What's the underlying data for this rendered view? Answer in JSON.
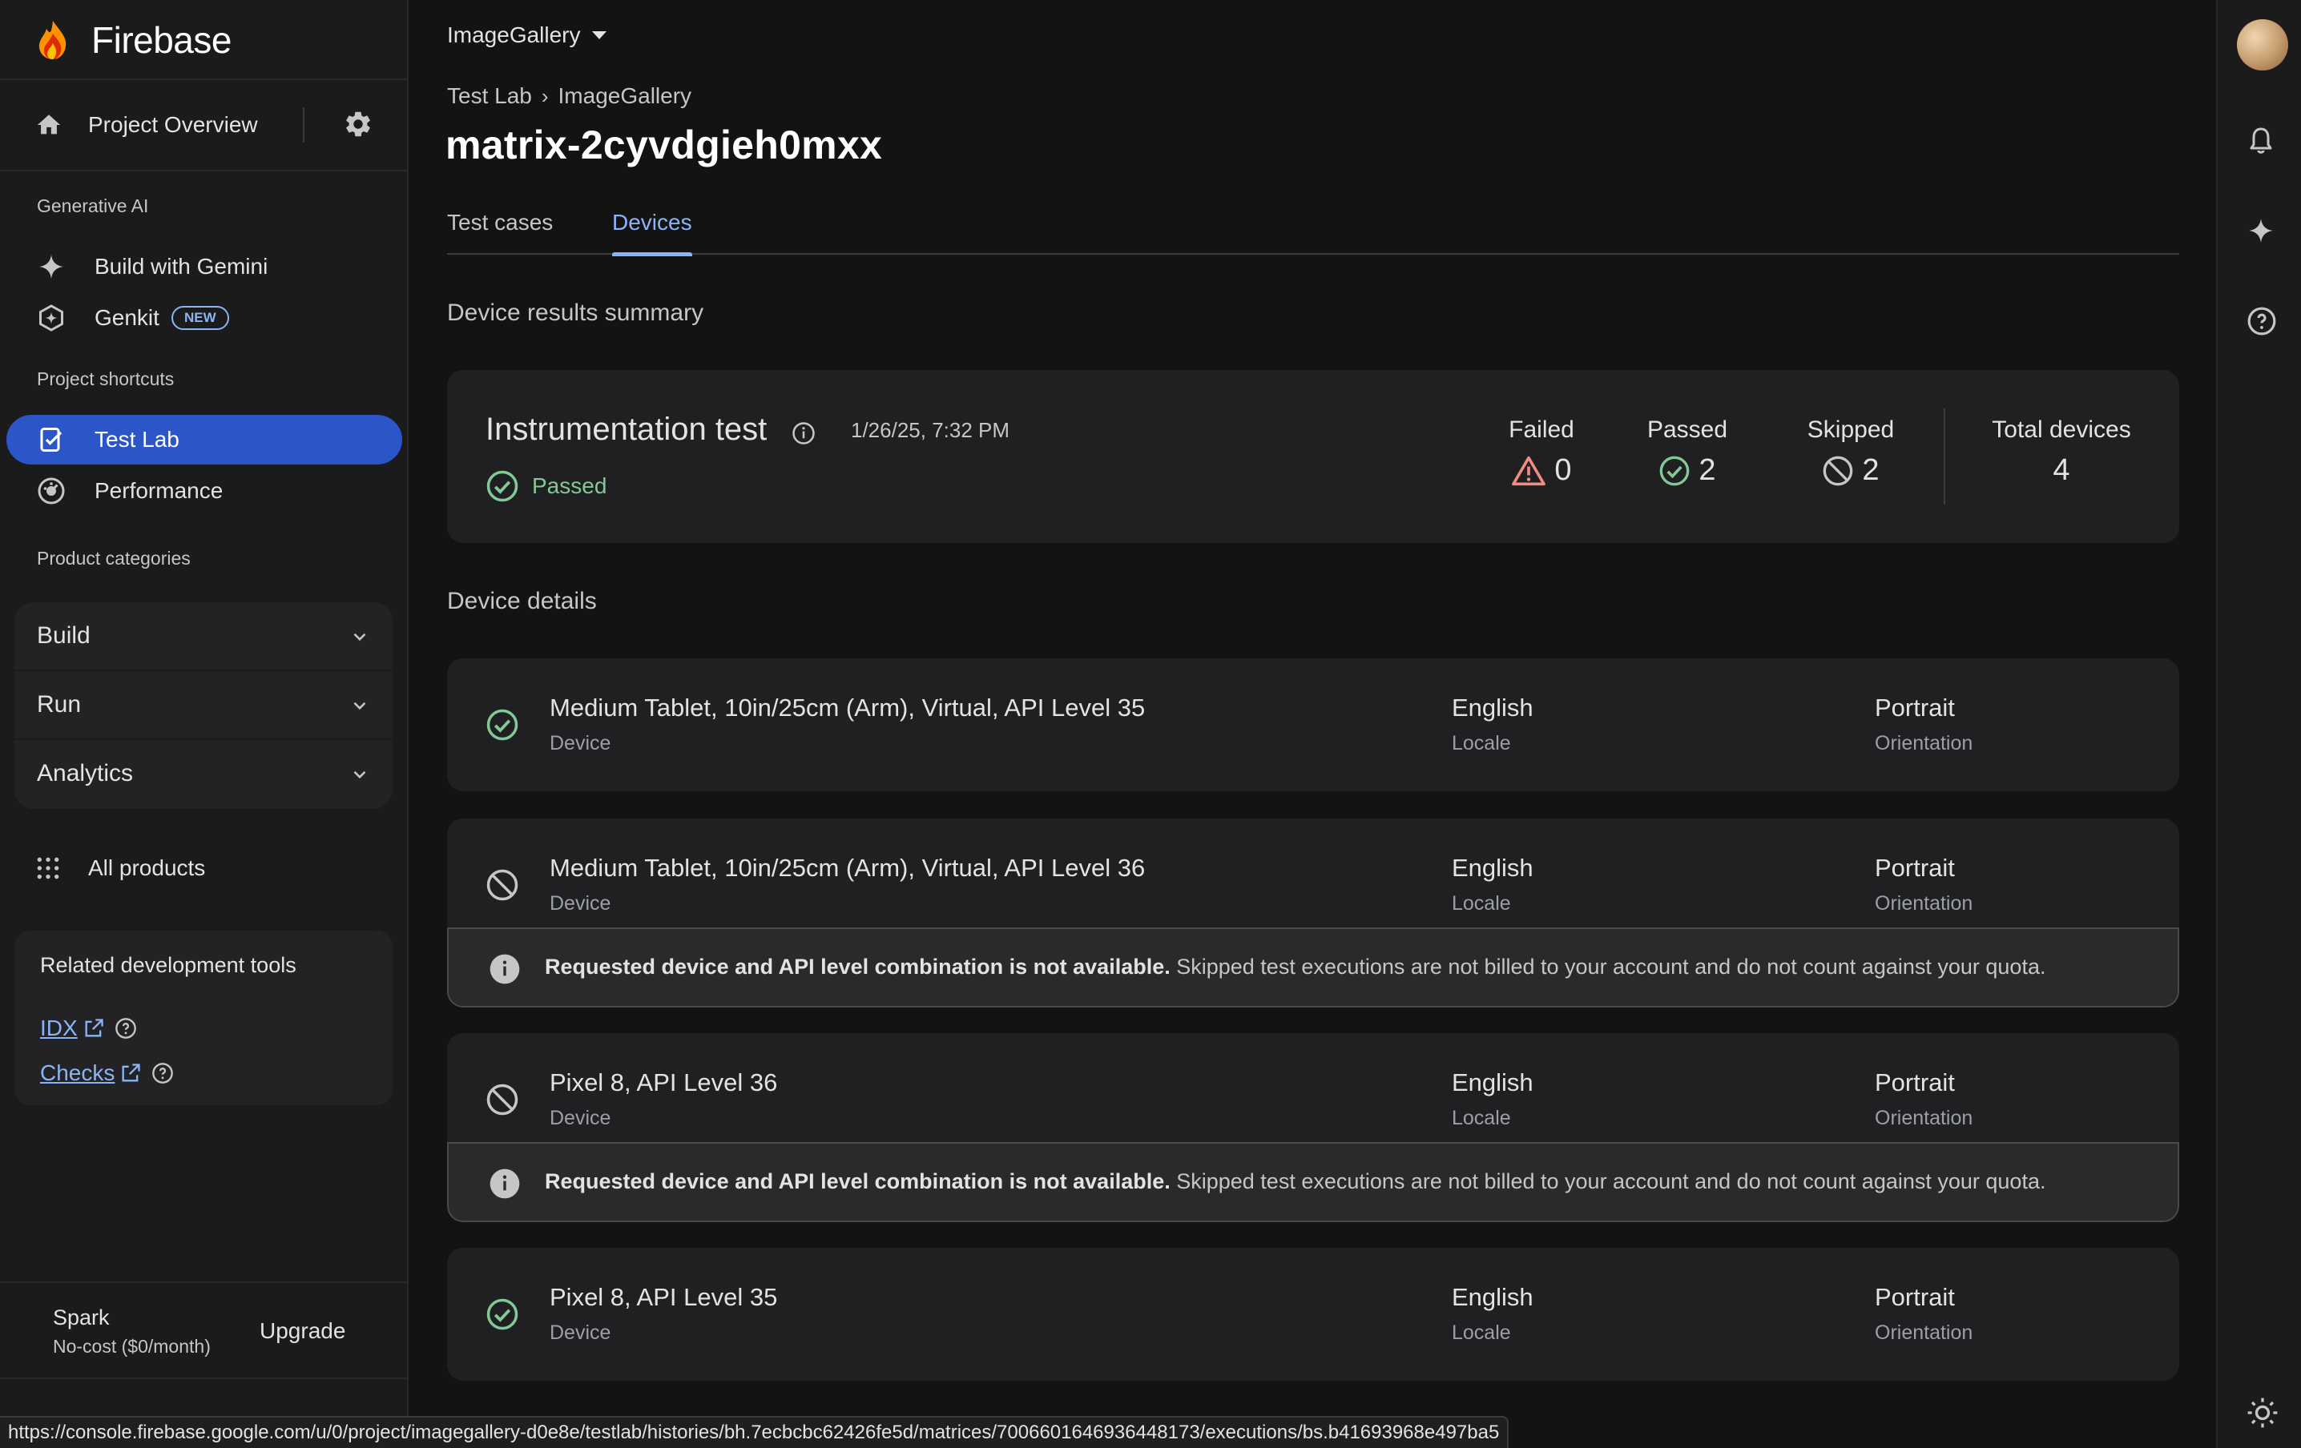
{
  "app": {
    "name": "Firebase"
  },
  "sidebar": {
    "project_overview": "Project Overview",
    "sections": {
      "generative_ai": "Generative AI",
      "project_shortcuts": "Project shortcuts",
      "product_categories": "Product categories"
    },
    "gen_ai_items": [
      {
        "label": "Build with Gemini",
        "icon": "sparkle-icon"
      },
      {
        "label": "Genkit",
        "icon": "genkit-icon",
        "badge": "NEW"
      }
    ],
    "shortcuts": [
      {
        "label": "Test Lab",
        "icon": "test-lab-icon",
        "active": true
      },
      {
        "label": "Performance",
        "icon": "performance-icon",
        "active": false
      }
    ],
    "categories": [
      {
        "label": "Build"
      },
      {
        "label": "Run"
      },
      {
        "label": "Analytics"
      }
    ],
    "all_products": "All products",
    "related": {
      "title": "Related development tools",
      "links": [
        {
          "label": "IDX"
        },
        {
          "label": "Checks"
        }
      ]
    },
    "plan": {
      "name": "Spark",
      "desc": "No-cost ($0/month)",
      "upgrade": "Upgrade"
    }
  },
  "header": {
    "project_selector": "ImageGallery",
    "breadcrumb": [
      "Test Lab",
      "ImageGallery"
    ],
    "title": "matrix-2cyvdgieh0mxx"
  },
  "tabs": [
    {
      "label": "Test cases",
      "active": false
    },
    {
      "label": "Devices",
      "active": true
    }
  ],
  "summary": {
    "heading": "Device results summary",
    "test_name": "Instrumentation test",
    "timestamp": "1/26/25, 7:32 PM",
    "status": "Passed",
    "stats": [
      {
        "label": "Failed",
        "value": "0",
        "icon": "warning-icon"
      },
      {
        "label": "Passed",
        "value": "2",
        "icon": "check-circle-icon"
      },
      {
        "label": "Skipped",
        "value": "2",
        "icon": "blocked-icon"
      },
      {
        "label": "Total devices",
        "value": "4"
      }
    ]
  },
  "details": {
    "heading": "Device details",
    "device_sub": "Device",
    "locale_sub": "Locale",
    "orientation_sub": "Orientation",
    "notice_bold": "Requested device and API level combination is not available.",
    "notice_rest": " Skipped test executions are not billed to your account and do not count against your quota.",
    "devices": [
      {
        "name": "Medium Tablet, 10in/25cm (Arm), Virtual, API Level 35",
        "locale": "English",
        "orientation": "Portrait",
        "status": "passed"
      },
      {
        "name": "Medium Tablet, 10in/25cm (Arm), Virtual, API Level 36",
        "locale": "English",
        "orientation": "Portrait",
        "status": "skipped"
      },
      {
        "name": "Pixel 8, API Level 36",
        "locale": "English",
        "orientation": "Portrait",
        "status": "skipped"
      },
      {
        "name": "Pixel 8, API Level 35",
        "locale": "English",
        "orientation": "Portrait",
        "status": "passed"
      }
    ]
  },
  "status_url": "https://console.firebase.google.com/u/0/project/imagegallery-d0e8e/testlab/histories/bh.7ecbcbc62426fe5d/matrices/7006601646936448173/executions/bs.b41693968e497ba5",
  "colors": {
    "accent": "#8ab4f8",
    "active_nav": "#2c55c8",
    "success": "#81c995",
    "warning": "#f28b82"
  }
}
